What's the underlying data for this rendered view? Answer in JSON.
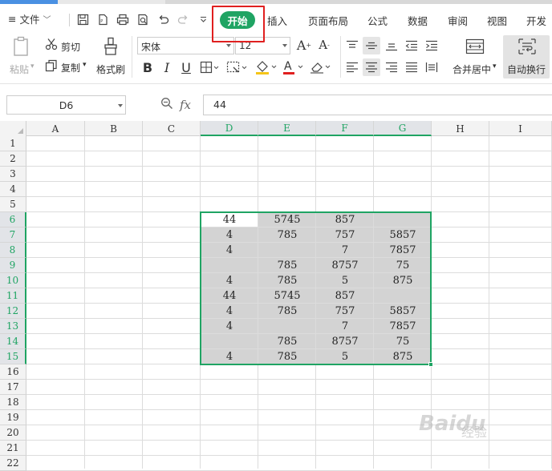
{
  "menu": {
    "file_label": "文件",
    "tabs": [
      "插入",
      "页面布局",
      "公式",
      "数据",
      "审阅",
      "视图",
      "开发"
    ],
    "active_tab": "开始"
  },
  "ribbon": {
    "paste_label": "粘贴",
    "cut_label": "剪切",
    "copy_label": "复制",
    "format_painter_label": "格式刷",
    "font_name": "宋体",
    "font_size": "12",
    "merge_center_label": "合并居中",
    "wrap_text_label": "自动换行"
  },
  "formula_bar": {
    "name_box": "D6",
    "fx_label": "fx",
    "value": "44"
  },
  "sheet": {
    "columns": [
      "A",
      "B",
      "C",
      "D",
      "E",
      "F",
      "G",
      "H",
      "I"
    ],
    "rows": [
      "1",
      "2",
      "3",
      "4",
      "5",
      "6",
      "7",
      "8",
      "9",
      "10",
      "11",
      "12",
      "13",
      "14",
      "15",
      "16",
      "17",
      "18",
      "19",
      "20",
      "21",
      "22"
    ],
    "selected_columns": [
      "D",
      "E",
      "F",
      "G"
    ],
    "selected_rows": [
      "6",
      "7",
      "8",
      "9",
      "10",
      "11",
      "12",
      "13",
      "14",
      "15"
    ],
    "cells": {
      "D6": "44",
      "E6": "5745",
      "F6": "857",
      "G6": "",
      "D7": "4",
      "E7": "785",
      "F7": "757",
      "G7": "5857",
      "D8": "4",
      "E8": "",
      "F8": "7",
      "G8": "7857",
      "D9": "",
      "E9": "785",
      "F9": "8757",
      "G9": "75",
      "D10": "4",
      "E10": "785",
      "F10": "5",
      "G10": "875",
      "D11": "44",
      "E11": "5745",
      "F11": "857",
      "G11": "",
      "D12": "4",
      "E12": "785",
      "F12": "757",
      "G12": "5857",
      "D13": "4",
      "E13": "",
      "F13": "7",
      "G13": "7857",
      "D14": "",
      "E14": "785",
      "F14": "8757",
      "G14": "75",
      "D15": "4",
      "E15": "785",
      "F15": "5",
      "G15": "875"
    }
  },
  "watermark": {
    "text": "Baidu",
    "sub": "经验"
  },
  "colors": {
    "accent": "#1fa463",
    "highlight_box": "#e02020",
    "selection_fill": "#d3d3d3"
  }
}
